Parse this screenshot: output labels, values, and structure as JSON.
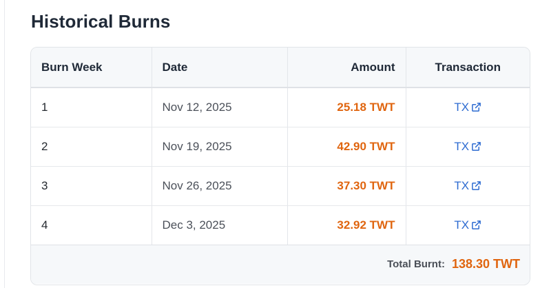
{
  "section": {
    "title": "Historical Burns"
  },
  "table": {
    "headers": {
      "week": "Burn Week",
      "date": "Date",
      "amount": "Amount",
      "transaction": "Transaction"
    },
    "rows": [
      {
        "week": "1",
        "date": "Nov 12, 2025",
        "amount": "25.18 TWT",
        "tx": "TX"
      },
      {
        "week": "2",
        "date": "Nov 19, 2025",
        "amount": "42.90 TWT",
        "tx": "TX"
      },
      {
        "week": "3",
        "date": "Nov 26, 2025",
        "amount": "37.30 TWT",
        "tx": "TX"
      },
      {
        "week": "4",
        "date": "Dec 3, 2025",
        "amount": "32.92 TWT",
        "tx": "TX"
      }
    ]
  },
  "footer": {
    "total_label": "Total Burnt:",
    "total_value": "138.30 TWT"
  },
  "colors": {
    "accent": "#e0650f",
    "link": "#2d6bd1",
    "header_bg": "#f6f8fa"
  },
  "icons": {
    "tx_link": "external-link-icon"
  }
}
